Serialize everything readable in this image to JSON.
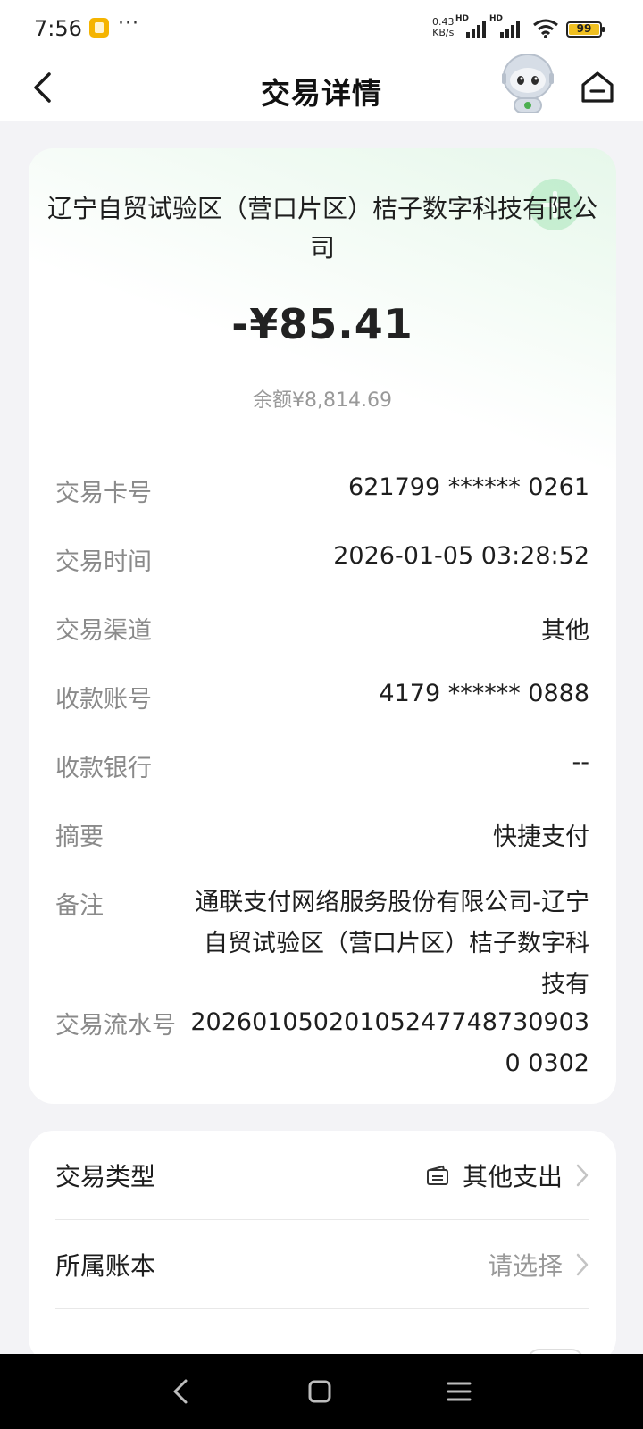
{
  "status_bar": {
    "time": "7:56",
    "more": "···",
    "net_speed_value": "0.43",
    "net_speed_unit": "KB/s",
    "signal1_label": "HD",
    "signal2_label": "HD",
    "battery": "99"
  },
  "header": {
    "title": "交易详情"
  },
  "transaction": {
    "merchant": "辽宁自贸试验区（营口片区）桔子数字科技有限公司",
    "amount": "-¥85.41",
    "balance": "余额¥8,814.69",
    "fields": {
      "card_no": {
        "label": "交易卡号",
        "value": "621799 ****** 0261"
      },
      "time": {
        "label": "交易时间",
        "value": "2026-01-05 03:28:52"
      },
      "channel": {
        "label": "交易渠道",
        "value": "其他"
      },
      "payee_account": {
        "label": "收款账号",
        "value": "4179 ****** 0888"
      },
      "payee_bank": {
        "label": "收款银行",
        "value": "--"
      },
      "summary": {
        "label": "摘要",
        "value": "快捷支付"
      },
      "remark": {
        "label": "备注",
        "value": "通联支付网络服务股份有限公司-辽宁自贸试验区（营口片区）桔子数字科技有"
      },
      "serial": {
        "label": "交易流水号",
        "value": "202601050201052477487309030 0302"
      }
    }
  },
  "options": {
    "type": {
      "label": "交易类型",
      "value": "其他支出",
      "icon": "wallet-icon"
    },
    "book": {
      "label": "所属账本",
      "placeholder": "请选择"
    }
  },
  "colors": {
    "background": "#f3f3f6",
    "card": "#ffffff",
    "label_gray": "#8a8a8a",
    "text": "#1e1e1e",
    "accent_green": "#96e1aa"
  }
}
